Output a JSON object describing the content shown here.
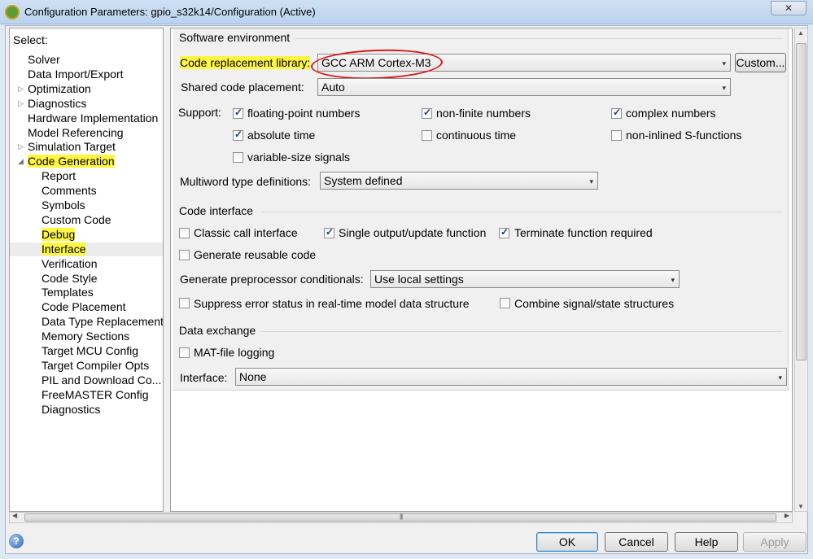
{
  "window": {
    "title": "Configuration Parameters: gpio_s32k14/Configuration (Active)",
    "close_glyph": "✕"
  },
  "tree": {
    "header": "Select:",
    "items": [
      {
        "label": "Solver",
        "expandable": false,
        "indent": 0
      },
      {
        "label": "Data Import/Export",
        "expandable": false,
        "indent": 0
      },
      {
        "label": "Optimization",
        "expandable": true,
        "indent": 0
      },
      {
        "label": "Diagnostics",
        "expandable": true,
        "indent": 0
      },
      {
        "label": "Hardware Implementation",
        "expandable": false,
        "indent": 0
      },
      {
        "label": "Model Referencing",
        "expandable": false,
        "indent": 0
      },
      {
        "label": "Simulation Target",
        "expandable": true,
        "indent": 0
      },
      {
        "label": "Code Generation",
        "expandable": true,
        "expanded": true,
        "indent": 0,
        "highlighted": true
      },
      {
        "label": "Report",
        "indent": 1
      },
      {
        "label": "Comments",
        "indent": 1
      },
      {
        "label": "Symbols",
        "indent": 1
      },
      {
        "label": "Custom Code",
        "indent": 1
      },
      {
        "label": "Debug",
        "indent": 1,
        "highlighted": true
      },
      {
        "label": "Interface",
        "indent": 1,
        "highlighted": true,
        "selected": true
      },
      {
        "label": "Verification",
        "indent": 1
      },
      {
        "label": "Code Style",
        "indent": 1
      },
      {
        "label": "Templates",
        "indent": 1
      },
      {
        "label": "Code Placement",
        "indent": 1
      },
      {
        "label": "Data Type Replacement",
        "indent": 1
      },
      {
        "label": "Memory Sections",
        "indent": 1
      },
      {
        "label": "Target MCU Config",
        "indent": 1
      },
      {
        "label": "Target Compiler Opts",
        "indent": 1
      },
      {
        "label": "PIL and Download Co...",
        "indent": 1
      },
      {
        "label": "FreeMASTER Config",
        "indent": 1
      },
      {
        "label": "Diagnostics",
        "indent": 1
      }
    ]
  },
  "software_env": {
    "section_title": "Software environment",
    "crl_label": "Code replacement library:",
    "crl_value": "GCC ARM Cortex-M3",
    "custom_button": "Custom...",
    "shared_label": "Shared code placement:",
    "shared_value": "Auto",
    "support_label": "Support:",
    "support": [
      {
        "label": "floating-point numbers",
        "checked": true
      },
      {
        "label": "non-finite numbers",
        "checked": true
      },
      {
        "label": "complex numbers",
        "checked": true
      },
      {
        "label": "absolute time",
        "checked": true
      },
      {
        "label": "continuous time",
        "checked": false
      },
      {
        "label": "non-inlined S-functions",
        "checked": false
      },
      {
        "label": "variable-size signals",
        "checked": false
      }
    ],
    "multiword_label": "Multiword type definitions:",
    "multiword_value": "System defined"
  },
  "code_interface": {
    "section_title": "Code interface",
    "classic": {
      "label": "Classic call interface",
      "checked": false
    },
    "single_output": {
      "label": "Single output/update function",
      "checked": true
    },
    "terminate": {
      "label": "Terminate function required",
      "checked": true
    },
    "reusable": {
      "label": "Generate reusable code",
      "checked": false
    },
    "preproc_label": "Generate preprocessor conditionals:",
    "preproc_value": "Use local settings",
    "suppress": {
      "label": "Suppress error status in real-time model data structure",
      "checked": false
    },
    "combine": {
      "label": "Combine signal/state structures",
      "checked": false
    }
  },
  "data_exchange": {
    "section_title": "Data exchange",
    "mat_logging": {
      "label": "MAT-file logging",
      "checked": false
    },
    "interface_label": "Interface:",
    "interface_value": "None"
  },
  "buttons": {
    "ok": "OK",
    "cancel": "Cancel",
    "help": "Help",
    "apply": "Apply",
    "help_icon": "?"
  },
  "colors": {
    "highlight": "#fff640",
    "annotation": "#d81a1a",
    "selection": "#ececec"
  },
  "icons": {
    "dropdown": "▾",
    "expand": "▷",
    "expanded": "◢"
  }
}
